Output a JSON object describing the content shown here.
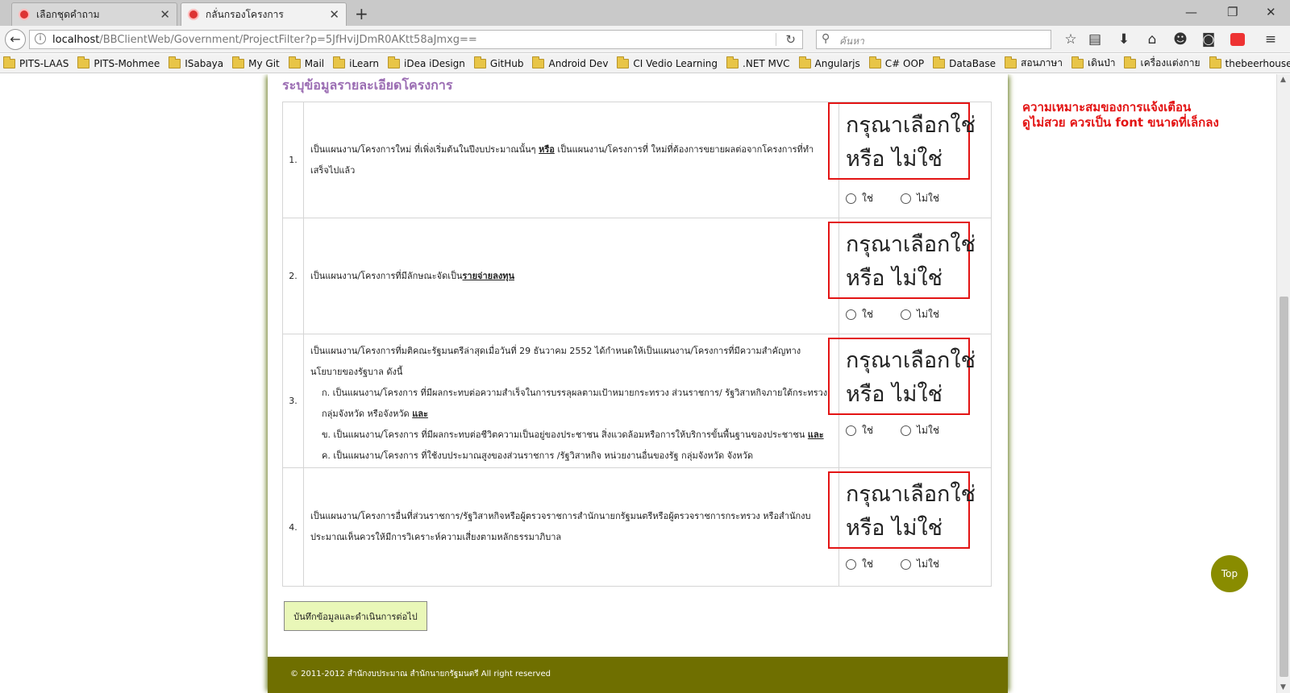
{
  "browser": {
    "tabs": [
      {
        "title": "เลือกชุดคำถาม"
      },
      {
        "title": "กลั่นกรองโครงการ"
      }
    ],
    "url": {
      "host": "localhost",
      "path": "/BBClientWeb/Government/ProjectFilter?p=5JfHviJDmR0AKtt58aJmxg=="
    },
    "search_placeholder": "ค้นหา",
    "bookmarks": [
      "PITS-LAAS",
      "PITS-Mohmee",
      "ISabaya",
      "My Git",
      "Mail",
      "iLearn",
      "iDea iDesign",
      "GitHub",
      "Android Dev",
      "CI Vedio Learning",
      ".NET MVC",
      "Angularjs",
      "C# OOP",
      "DataBase",
      "สอนภาษา",
      "เดินป่า",
      "เครื่องแต่งกาย",
      "thebeerhouse"
    ]
  },
  "form": {
    "section_title": "ระบุข้อมูลรายละเอียดโครงการ",
    "validation_message": {
      "line1": "กรุณาเลือกใช่",
      "line2": "หรือ ไม่ใช่"
    },
    "options": {
      "yes": "ใช่",
      "no": "ไม่ใช่"
    },
    "questions": [
      {
        "number": "1.",
        "text_a": "เป็นแผนงาน/โครงการใหม่ ที่เพิ่งเริ่มต้นในปีงบประมาณนั้นๆ ",
        "em": "หรือ",
        "text_b": " เป็นแผนงาน/โครงการที่ ใหม่ที่ต้องการขยายผลต่อจากโครงการที่ทำเสร็จไปแล้ว"
      },
      {
        "number": "2.",
        "text_a": "เป็นแผนงาน/โครงการที่มีลักษณะจัดเป็น",
        "em": "รายจ่ายลงทุน"
      },
      {
        "number": "3.",
        "intro": "เป็นแผนงาน/โครงการที่มติคณะรัฐมนตรีล่าสุดเมื่อวันที่ 29 ธันวาคม 2552 ได้กำหนดให้เป็นแผนงาน/โครงการที่มีความสำคัญทางนโยบายของรัฐบาล ดังนี้",
        "items": [
          {
            "text": "ก. เป็นแผนงาน/โครงการ ที่มีผลกระทบต่อความสำเร็จในการบรรลุผลตามเป้าหมายกระทรวง ส่วนราชการ/ รัฐวิสาหกิจภายใต้กระทรวง กลุ่มจังหวัด หรือจังหวัด ",
            "em": "และ"
          },
          {
            "text": "ข. เป็นแผนงาน/โครงการ ที่มีผลกระทบต่อชีวิตความเป็นอยู่ของประชาชน สิ่งแวดล้อมหรือการให้บริการขั้นพื้นฐานของประชาชน ",
            "em": "และ"
          },
          {
            "text": "ค. เป็นแผนงาน/โครงการ ที่ใช้งบประมาณสูงของส่วนราชการ /รัฐวิสาหกิจ หน่วยงานอื่นของรัฐ กลุ่มจังหวัด จังหวัด",
            "em": ""
          }
        ]
      },
      {
        "number": "4.",
        "text_a": "เป็นแผนงาน/โครงการอื่นที่ส่วนราชการ/รัฐวิสาหกิจหรือผู้ตรวจราชการสำนักนายกรัฐมนตรีหรือผู้ตรวจราชการกระทรวง หรือสำนักงบประมาณเห็นควรให้มีการวิเคราะห์ความเสี่ยงตามหลักธรรมาภิบาล",
        "em": ""
      }
    ],
    "save_button": "บันทึกข้อมูลและดำเนินการต่อไป"
  },
  "footer": "© 2011-2012 สำนักงบประมาณ สำนักนายกรัฐมนตรี All right reserved",
  "annotation": {
    "line1": "ความเหมาะสมของการแจ้งเตือน",
    "line2": "ดูไม่สวย ควรเป็น font ขนาดที่เล็กลง"
  },
  "top_button": "Top"
}
